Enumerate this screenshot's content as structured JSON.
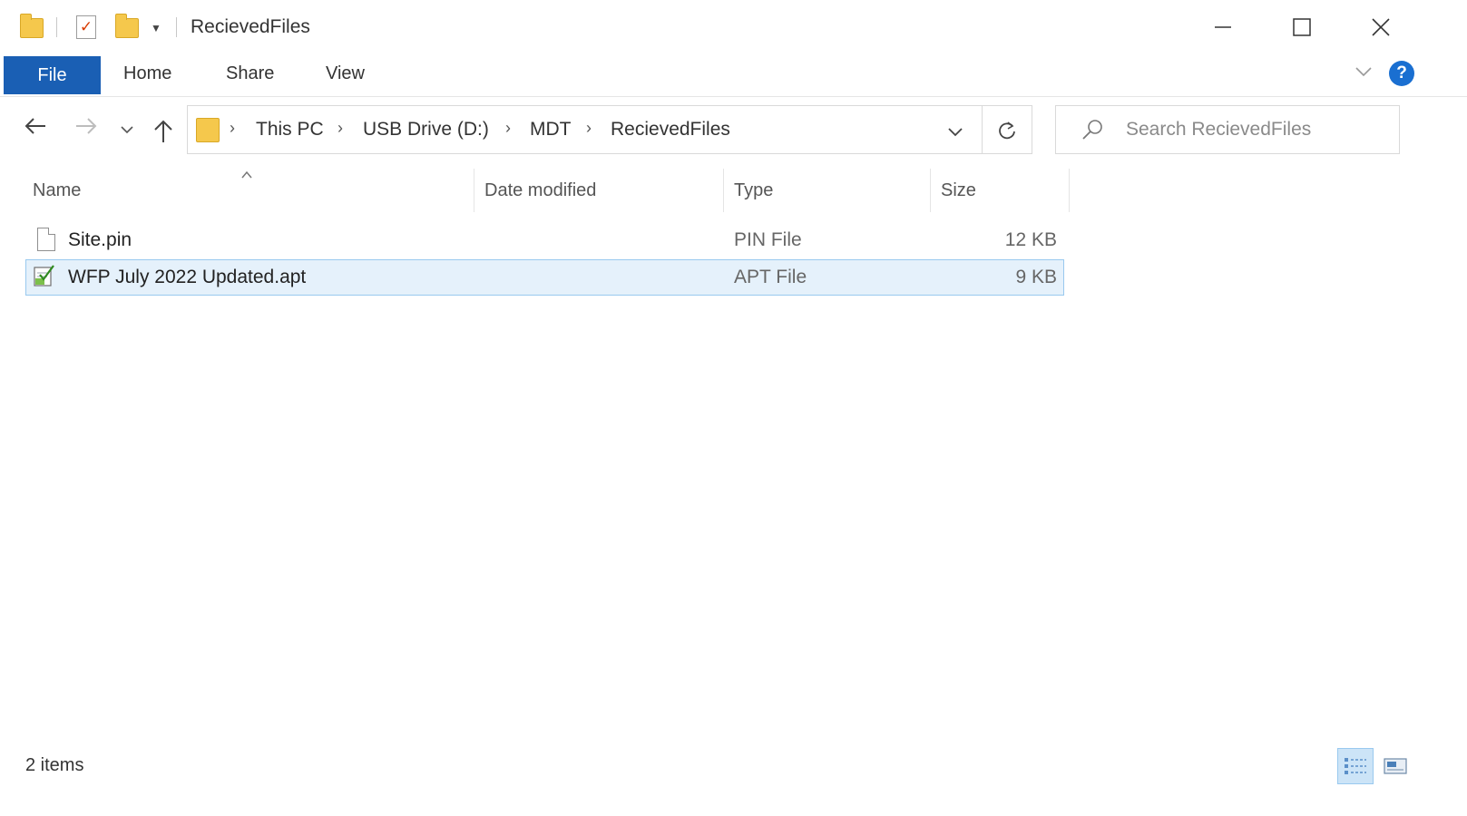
{
  "window": {
    "title": "RecievedFiles",
    "minimize_glyph": "—",
    "maximize_glyph": "☐",
    "close_glyph": "✕"
  },
  "ribbon": {
    "file_tab": "File",
    "tabs": [
      "Home",
      "Share",
      "View"
    ]
  },
  "address_bar": {
    "breadcrumbs": [
      "This PC",
      "USB Drive (D:)",
      "MDT",
      "RecievedFiles"
    ]
  },
  "search": {
    "placeholder": "Search RecievedFiles"
  },
  "columns": {
    "name": "Name",
    "date_modified": "Date modified",
    "type": "Type",
    "size": "Size"
  },
  "files": [
    {
      "name": "Site.pin",
      "date_modified": "",
      "type": "PIN File",
      "size": "12 KB",
      "icon": "document-icon",
      "selected": false
    },
    {
      "name": "WFP July 2022 Updated.apt",
      "date_modified": "",
      "type": "APT File",
      "size": "9 KB",
      "icon": "apt-file-icon",
      "selected": true
    }
  ],
  "status_bar": {
    "item_count": "2 items"
  },
  "colors": {
    "file_tab": "#1a5fb4",
    "selection_bg": "#e5f1fb",
    "selection_border": "#99c9ef",
    "folder": "#f5c84c",
    "help": "#1a6fd1"
  }
}
